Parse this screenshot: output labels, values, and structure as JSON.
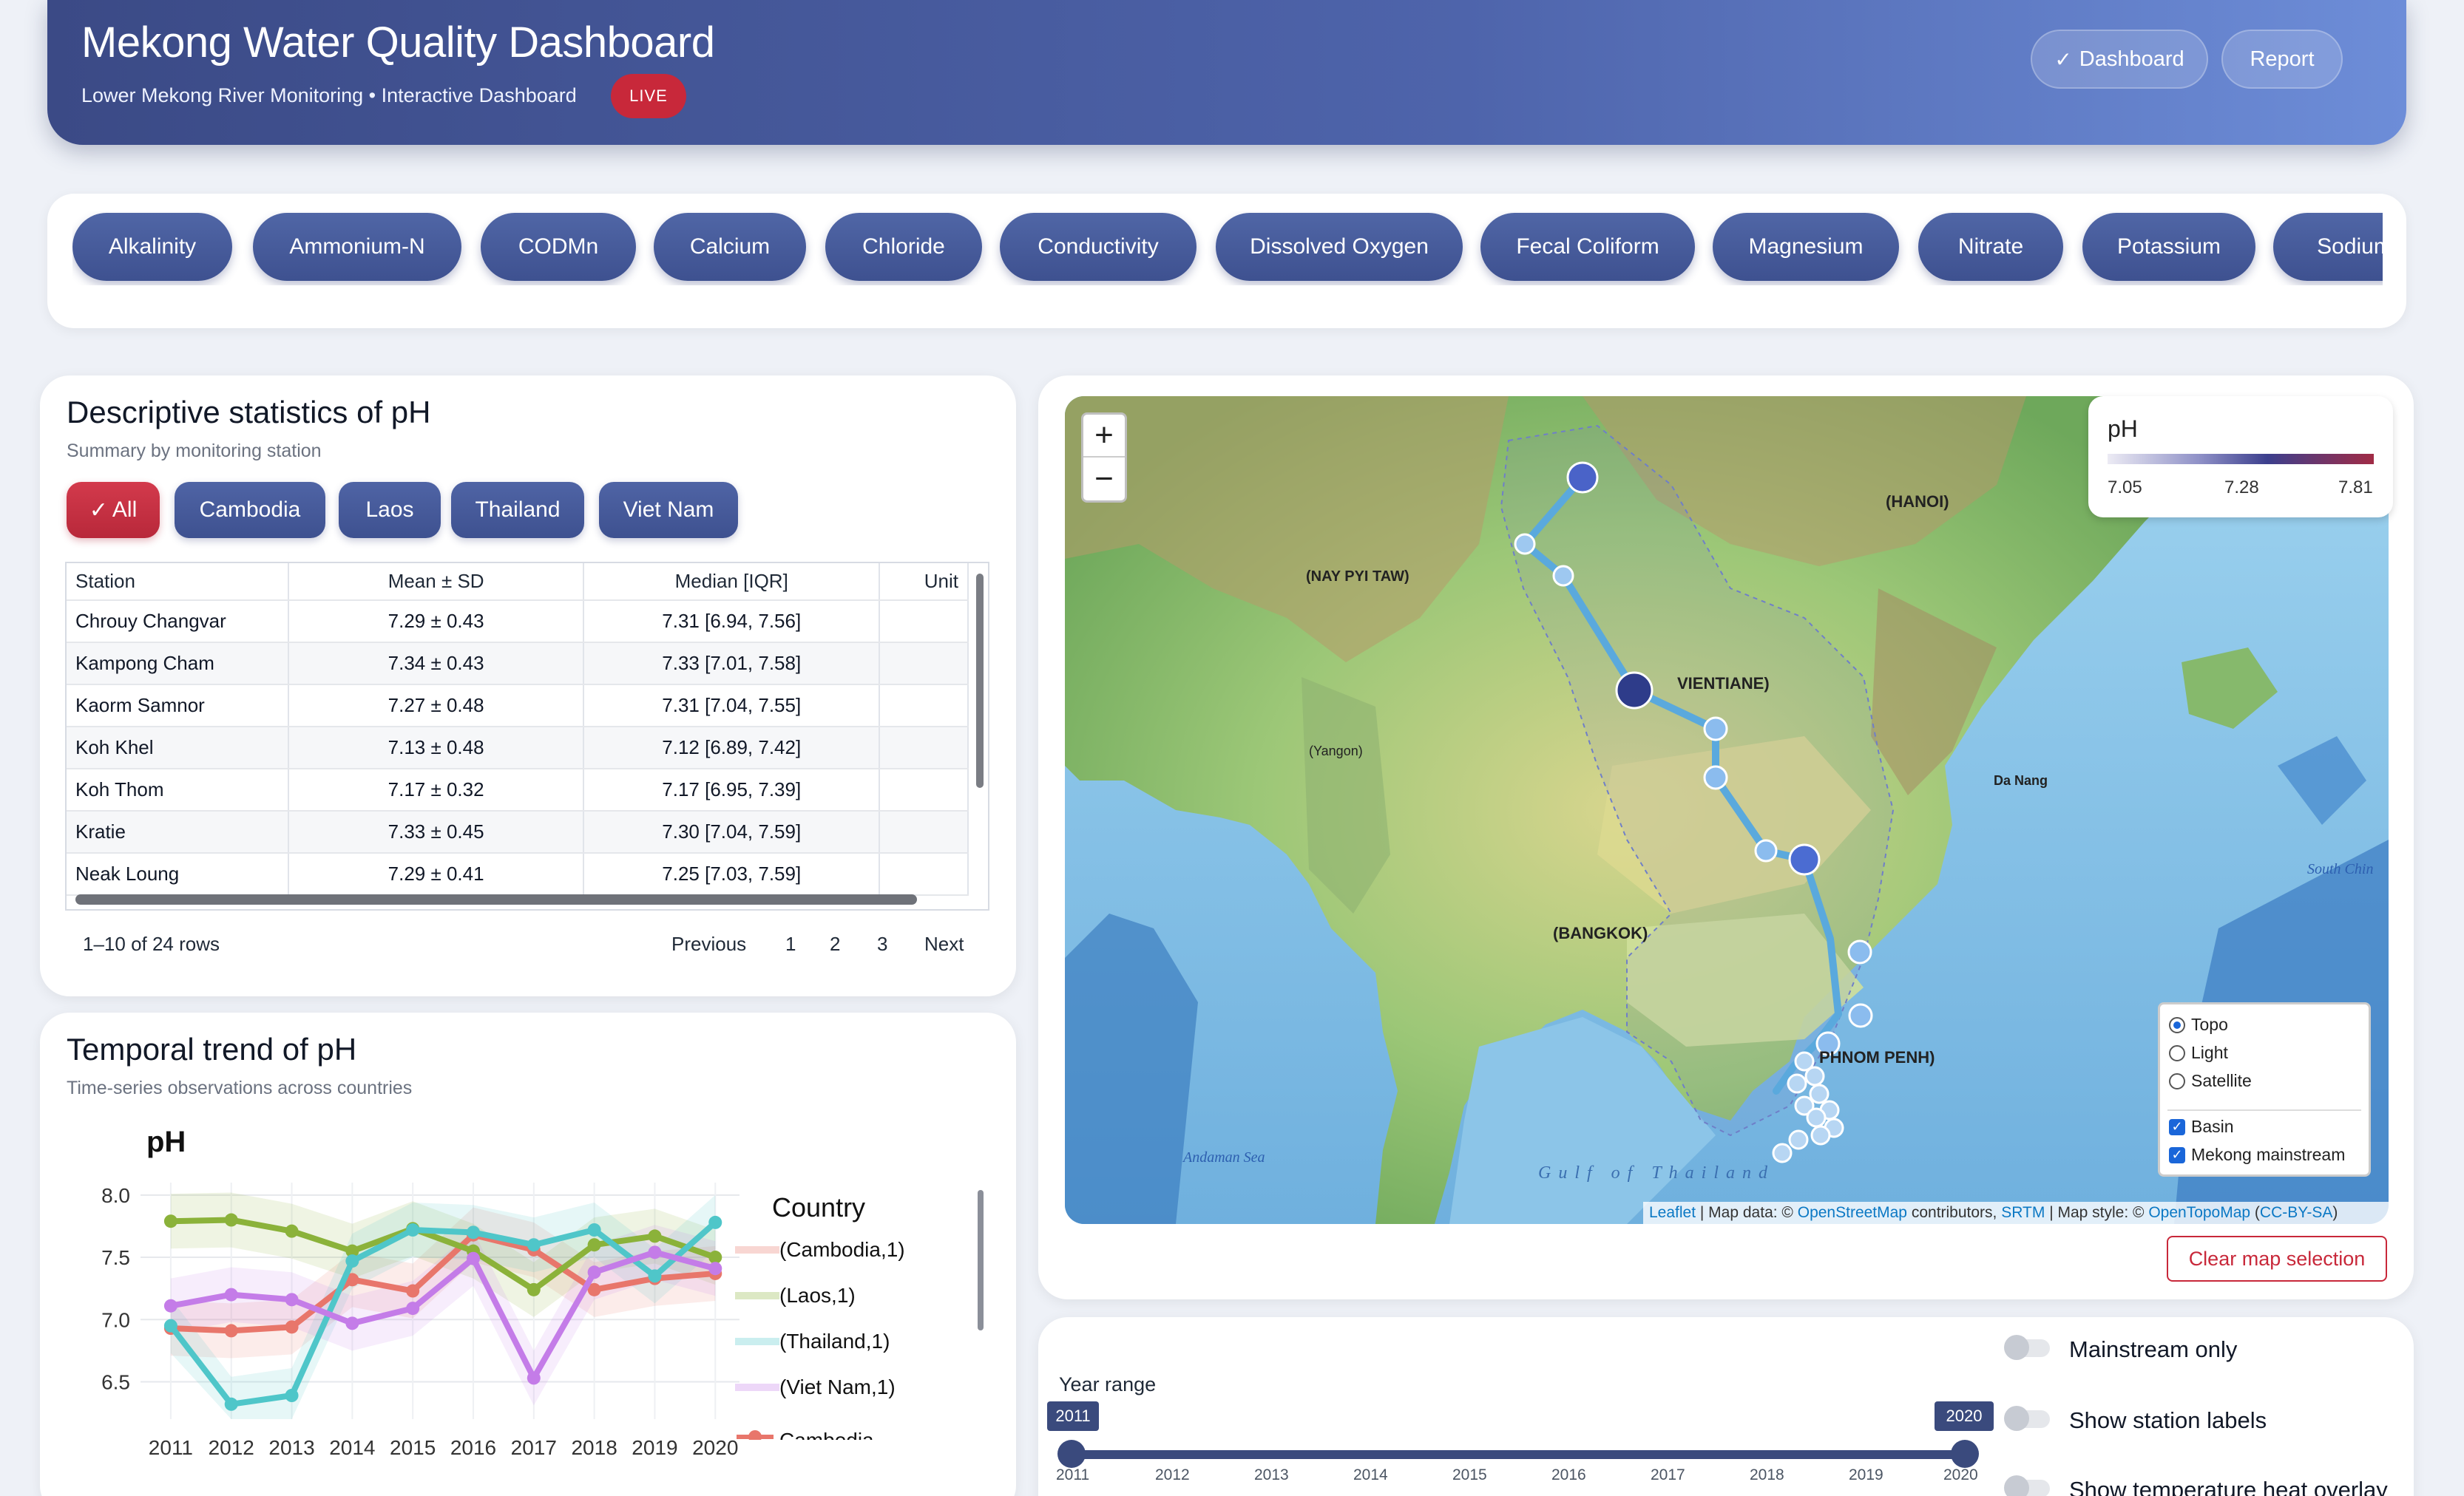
{
  "header": {
    "title": "Mekong Water Quality Dashboard",
    "subtitle": "Lower Mekong River Monitoring • Interactive Dashboard",
    "live": "LIVE",
    "dashboard_btn": "Dashboard",
    "report_btn": "Report"
  },
  "variables": [
    "Alkalinity",
    "Ammonium-N",
    "CODMn",
    "Calcium",
    "Chloride",
    "Conductivity",
    "Dissolved Oxygen",
    "Fecal Coliform",
    "Magnesium",
    "Nitrate",
    "Potassium",
    "Sodium"
  ],
  "stats": {
    "title": "Descriptive statistics of pH",
    "subtitle": "Summary by monitoring station",
    "filters": [
      "All",
      "Cambodia",
      "Laos",
      "Thailand",
      "Viet Nam"
    ],
    "columns": [
      "Station",
      "Mean ± SD",
      "Median [IQR]",
      "Unit"
    ],
    "rows": [
      [
        "Chrouy Changvar",
        "7.29 ± 0.43",
        "7.31 [6.94, 7.56]",
        ""
      ],
      [
        "Kampong Cham",
        "7.34 ± 0.43",
        "7.33 [7.01, 7.58]",
        ""
      ],
      [
        "Kaorm Samnor",
        "7.27 ± 0.48",
        "7.31 [7.04, 7.55]",
        ""
      ],
      [
        "Koh Khel",
        "7.13 ± 0.48",
        "7.12 [6.89, 7.42]",
        ""
      ],
      [
        "Koh Thom",
        "7.17 ± 0.32",
        "7.17 [6.95, 7.39]",
        ""
      ],
      [
        "Kratie",
        "7.33 ± 0.45",
        "7.30 [7.04, 7.59]",
        ""
      ],
      [
        "Neak Loung",
        "7.29 ± 0.41",
        "7.25 [7.03, 7.59]",
        ""
      ]
    ],
    "pager_info": "1–10 of 24 rows",
    "pager": [
      "Previous",
      "1",
      "2",
      "3",
      "Next"
    ]
  },
  "trend": {
    "title": "Temporal trend of pH",
    "subtitle": "Time-series observations across countries"
  },
  "chart_data": {
    "type": "line",
    "title": "pH",
    "legend_title": "Country",
    "x": [
      2011,
      2012,
      2013,
      2014,
      2015,
      2016,
      2017,
      2018,
      2019,
      2020
    ],
    "ylim": [
      6.2,
      8.1
    ],
    "yticks": [
      6.5,
      7.0,
      7.5,
      8.0
    ],
    "series": [
      {
        "name": "(Cambodia,1)",
        "color": "#e8766b",
        "values": [
          6.93,
          6.91,
          6.94,
          7.32,
          7.23,
          7.68,
          7.56,
          7.24,
          7.33,
          7.37
        ]
      },
      {
        "name": "(Laos,1)",
        "color": "#8bb23a",
        "values": [
          7.79,
          7.8,
          7.71,
          7.55,
          7.73,
          7.55,
          7.24,
          7.6,
          7.67,
          7.5
        ]
      },
      {
        "name": "(Thailand,1)",
        "color": "#4fc6c9",
        "values": [
          6.95,
          6.32,
          6.39,
          7.47,
          7.72,
          7.7,
          7.6,
          7.72,
          7.35,
          7.78
        ]
      },
      {
        "name": "(Viet Nam,1)",
        "color": "#c47ce8",
        "values": [
          7.11,
          7.2,
          7.16,
          6.97,
          7.09,
          7.49,
          6.53,
          7.38,
          7.54,
          7.41
        ]
      }
    ],
    "legend_partial": "Cambodia"
  },
  "map": {
    "legend_title": "pH",
    "legend_ticks": [
      "7.05",
      "7.28",
      "7.81"
    ],
    "zoom_in": "+",
    "zoom_out": "−",
    "layers": [
      "Topo",
      "Light",
      "Satellite"
    ],
    "overlays": [
      "Basin",
      "Mekong mainstream"
    ],
    "attribution": {
      "leaflet": "Leaflet",
      "t1": " | Map data: © ",
      "osm": "OpenStreetMap",
      "t2": " contributors, ",
      "srtm": "SRTM",
      "t3": " | Map style: © ",
      "otm": "OpenTopoMap",
      "t4": " (",
      "cc": "CC-BY-SA",
      "t5": ")"
    },
    "labels": {
      "vientiane": "VIENTIANE)",
      "phnom": "PHNOM PENH)",
      "bangkok": "(BANGKOK)",
      "hanoi": "(HANOI)",
      "naypyi": "(NAY PYI TAW)",
      "yangon": "(Yangon)",
      "danang": "Da Nang",
      "gulf": "Gulf of Thailand",
      "andaman": "Andaman Sea",
      "southchina": "South Chin"
    },
    "clear_btn": "Clear map selection"
  },
  "controls": {
    "mainstream_only": "Mainstream only",
    "station_labels": "Show station labels",
    "heat_overlay": "Show temperature heat overlay",
    "year_range_label": "Year range",
    "year_min": "2011",
    "year_max": "2020",
    "ticks": [
      "2011",
      "2012",
      "2013",
      "2014",
      "2015",
      "2016",
      "2017",
      "2018",
      "2019",
      "2020"
    ]
  }
}
